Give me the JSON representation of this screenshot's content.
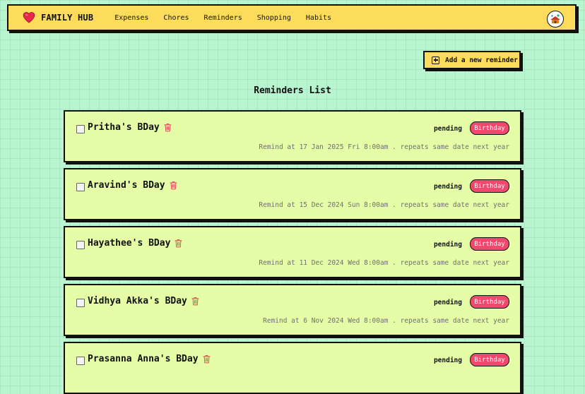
{
  "nav": {
    "brand": "FAMILY HUB",
    "links": [
      "Expenses",
      "Chores",
      "Reminders",
      "Shopping",
      "Habits"
    ]
  },
  "actions": {
    "add_label": "Add a new reminder"
  },
  "list_title": "Reminders List",
  "reminders": [
    {
      "title": "Pritha's BDay",
      "status": "pending",
      "tag": "Birthday",
      "meta": "Remind at 17 Jan 2025 Fri 8:00am . repeats same date next year"
    },
    {
      "title": "Aravind's BDay",
      "status": "pending",
      "tag": "Birthday",
      "meta": "Remind at 15 Dec 2024 Sun 8:00am . repeats same date next year"
    },
    {
      "title": "Hayathee's BDay",
      "status": "pending",
      "tag": "Birthday",
      "meta": "Remind at 11 Dec 2024 Wed 8:00am . repeats same date next year"
    },
    {
      "title": "Vidhya Akka's BDay",
      "status": "pending",
      "tag": "Birthday",
      "meta": "Remind at 6 Nov 2024 Wed 8:00am . repeats same date next year"
    },
    {
      "title": "Prasanna Anna's BDay",
      "status": "pending",
      "tag": "Birthday",
      "meta": ""
    }
  ],
  "icons": {
    "brand": "heart-icon",
    "add": "plus-square-icon",
    "delete": "trash-icon",
    "avatar": "avatar-icon"
  },
  "colors": {
    "background": "#b8f5d0",
    "navbar": "#fddc5c",
    "card": "#e4fda6",
    "badge": "#ef4a6e",
    "trash": "#e0475a"
  }
}
